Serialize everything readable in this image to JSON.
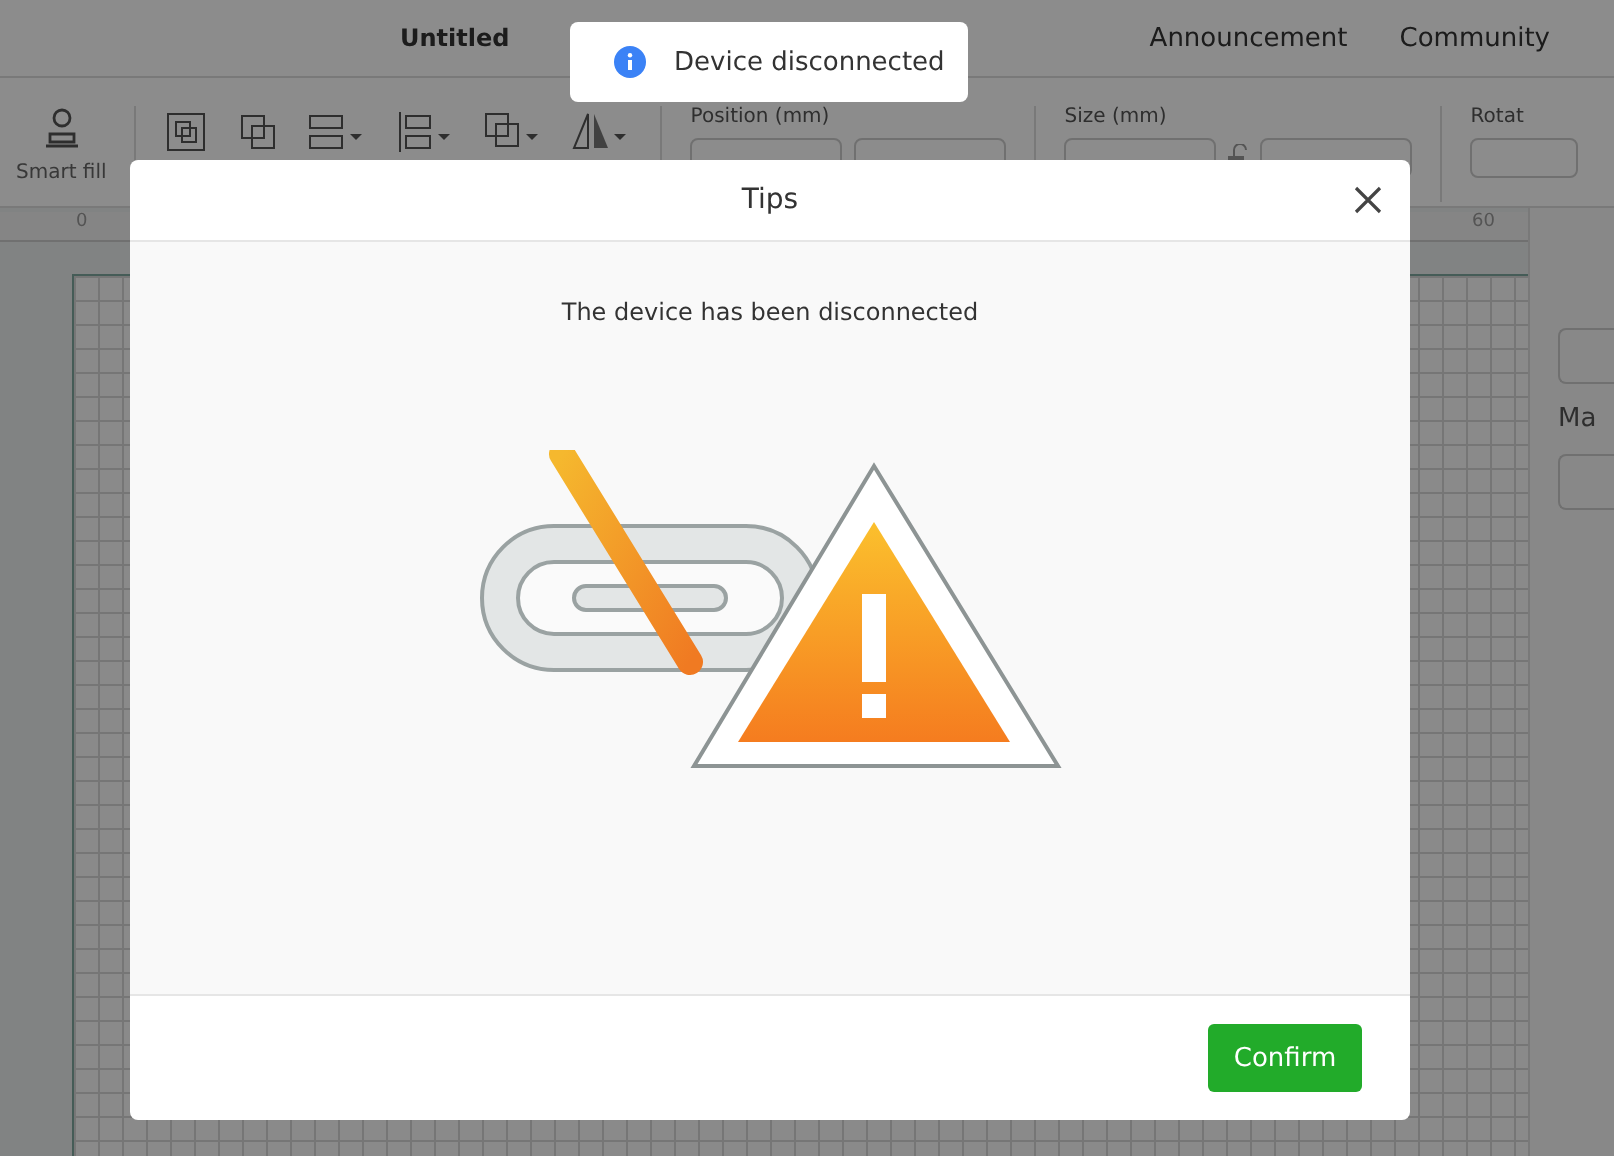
{
  "window": {
    "title": "Untitled"
  },
  "nav": [
    "Announcement",
    "Community"
  ],
  "toolbar": {
    "smart_fill": "Smart fill",
    "position": {
      "label": "Position (mm)"
    },
    "size": {
      "label": "Size (mm)"
    },
    "rotate_label": "Rotat"
  },
  "ruler": [
    "0",
    "60"
  ],
  "side_panel": {
    "label": "Ma"
  },
  "toast": {
    "text": "Device disconnected"
  },
  "dialog": {
    "title": "Tips",
    "message": "The device has been disconnected",
    "confirm": "Confirm"
  }
}
